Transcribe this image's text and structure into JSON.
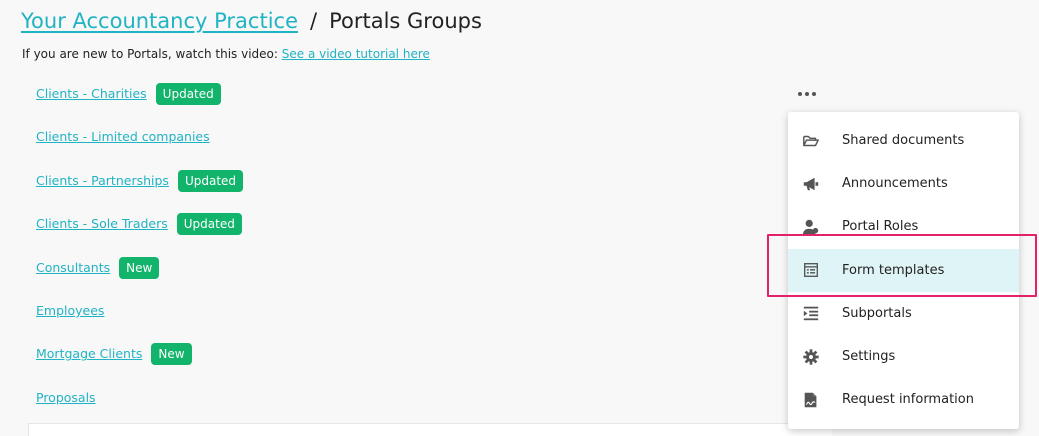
{
  "breadcrumb": {
    "parent_label": "Your Accountancy Practice",
    "separator": "/",
    "current": "Portals Groups"
  },
  "intro": {
    "text": "If you are new to Portals, watch this video:",
    "link_label": "See a video tutorial here"
  },
  "groups": [
    {
      "label": "Clients - Charities",
      "badge": "Updated"
    },
    {
      "label": "Clients - Limited companies",
      "badge": ""
    },
    {
      "label": "Clients - Partnerships",
      "badge": "Updated"
    },
    {
      "label": "Clients - Sole Traders",
      "badge": "Updated"
    },
    {
      "label": "Consultants",
      "badge": "New"
    },
    {
      "label": "Employees",
      "badge": ""
    },
    {
      "label": "Mortgage Clients",
      "badge": "New"
    },
    {
      "label": "Proposals",
      "badge": ""
    }
  ],
  "menu": {
    "items": [
      {
        "label": "Shared documents",
        "icon": "folder-open-icon"
      },
      {
        "label": "Announcements",
        "icon": "megaphone-icon"
      },
      {
        "label": "Portal Roles",
        "icon": "user-roles-icon"
      },
      {
        "label": "Form templates",
        "icon": "form-template-icon",
        "highlighted": true
      },
      {
        "label": "Subportals",
        "icon": "indent-list-icon"
      },
      {
        "label": "Settings",
        "icon": "gear-icon"
      },
      {
        "label": "Request information",
        "icon": "document-signature-icon"
      }
    ]
  },
  "colors": {
    "link": "#20b3c3",
    "badge": "#12b36b",
    "highlight": "#e5206a",
    "active_row": "#dff4f7"
  }
}
